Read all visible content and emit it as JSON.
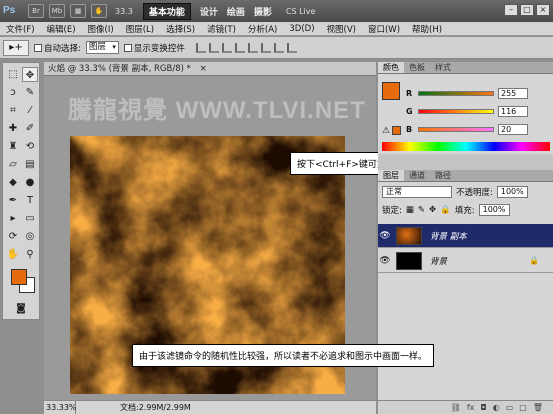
{
  "titlebar": {
    "app_logo": "Ps",
    "icons": [
      "Br",
      "Mb"
    ],
    "zoom": "33.3",
    "workspaces": [
      "基本功能",
      "设计",
      "绘画",
      "摄影"
    ],
    "cs_live": "CS Live"
  },
  "menu": [
    "文件(F)",
    "编辑(E)",
    "图像(I)",
    "图层(L)",
    "选择(S)",
    "滤镜(T)",
    "分析(A)",
    "3D(D)",
    "视图(V)",
    "窗口(W)",
    "帮助(H)"
  ],
  "options": {
    "auto_select_label": "自动选择:",
    "auto_select_value": "图层",
    "show_transform_label": "显示变换控件"
  },
  "document": {
    "tab_title": "火焰 @ 33.3% (背景 副本, RGB/8) *",
    "watermark": "騰龍視覺 WWW.TLVI.NET",
    "status_zoom": "33.33%",
    "status_doc": "文档:2.99M/2.99M"
  },
  "callouts": {
    "top": "按下<Ctrl+F>键可重复执行上次滤镜命令",
    "bottom": "由于该滤镜命令的随机性比较强，所以读者不必追求和图示中画面一样。"
  },
  "color_panel": {
    "tabs": [
      "颜色",
      "色板",
      "样式"
    ],
    "channels": [
      {
        "label": "R",
        "value": "255"
      },
      {
        "label": "G",
        "value": "116"
      },
      {
        "label": "B",
        "value": "20"
      }
    ],
    "fg_color": "#e66b0c"
  },
  "layers_panel": {
    "tabs": [
      "图层",
      "通道",
      "路径"
    ],
    "blend_mode": "正常",
    "opacity_label": "不透明度:",
    "opacity_value": "100%",
    "lock_label": "锁定:",
    "fill_label": "填充:",
    "fill_value": "100%",
    "layers": [
      {
        "name": "背景 副本",
        "selected": true
      },
      {
        "name": "背景",
        "selected": false,
        "locked": true
      }
    ]
  }
}
